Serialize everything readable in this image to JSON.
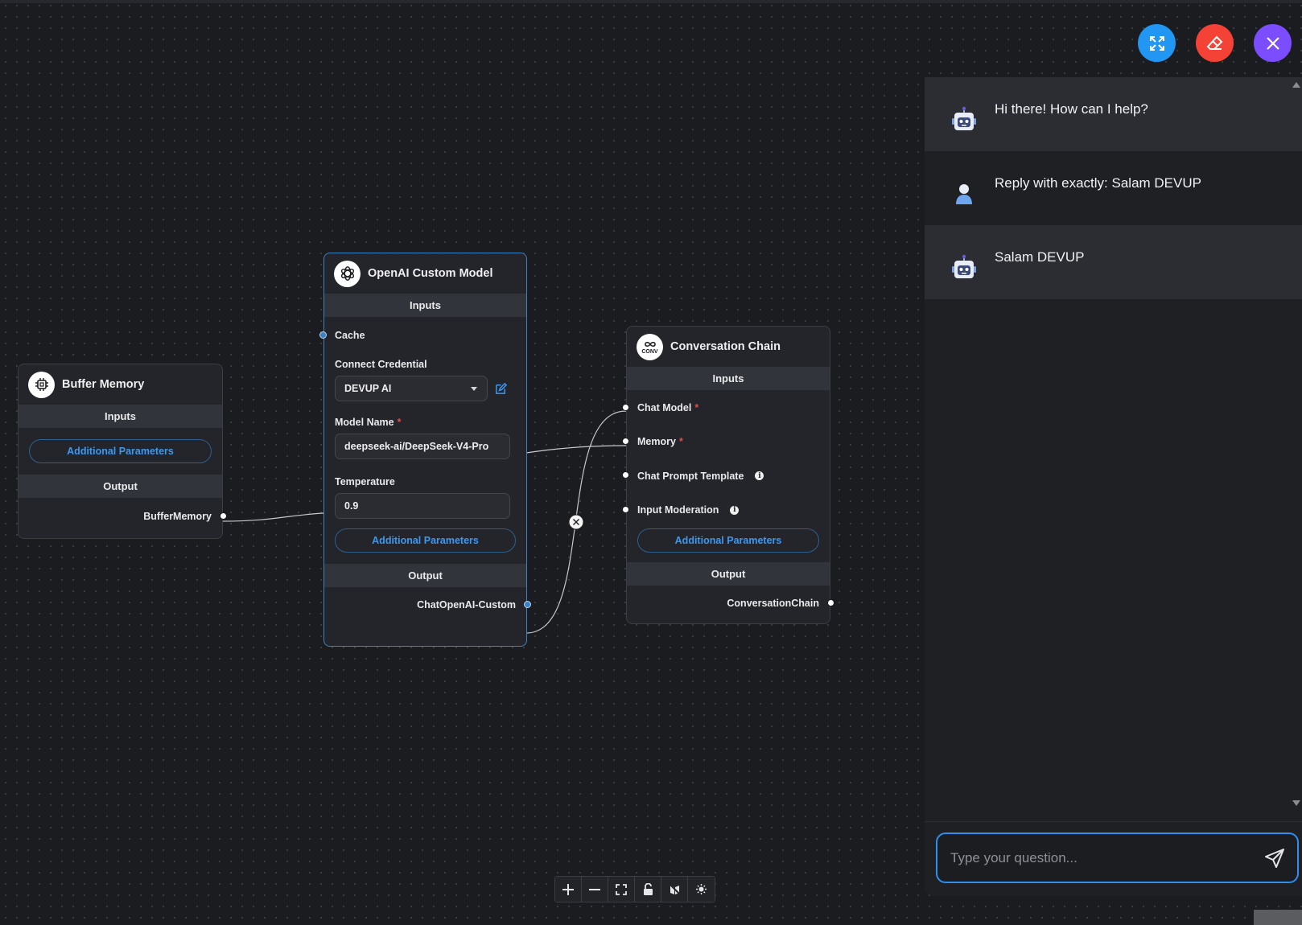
{
  "canvas": {
    "edges": [
      {
        "from": "BufferMemory",
        "to": "Memory"
      },
      {
        "from": "ChatOpenAI-Custom",
        "to": "Chat Model"
      }
    ]
  },
  "nodes": {
    "buffer_memory": {
      "title": "Buffer Memory",
      "icon": "chip-icon",
      "inputs_label": "Inputs",
      "additional_params": "Additional Parameters",
      "output_label": "Output",
      "output": "BufferMemory"
    },
    "openai_custom": {
      "title": "OpenAI Custom Model",
      "icon": "openai-icon",
      "inputs_label": "Inputs",
      "cache_label": "Cache",
      "credential_label": "Connect Credential",
      "credential_value": "DEVUP AI",
      "model_name_label": "Model Name",
      "model_name_value": "deepseek-ai/DeepSeek-V4-Pro",
      "temperature_label": "Temperature",
      "temperature_value": "0.9",
      "additional_params": "Additional Parameters",
      "output_label": "Output",
      "output": "ChatOpenAI-Custom"
    },
    "conversation_chain": {
      "title": "Conversation Chain",
      "icon": "conv-icon",
      "icon_text": "CONV",
      "inputs_label": "Inputs",
      "chat_model_label": "Chat Model",
      "memory_label": "Memory",
      "prompt_label": "Chat Prompt Template",
      "moderation_label": "Input Moderation",
      "additional_params": "Additional Parameters",
      "output_label": "Output",
      "output": "ConversationChain"
    }
  },
  "fabs": {
    "expand_color": "#2196f3",
    "clear_color": "#f44336",
    "close_color": "#7c4dff"
  },
  "chat": {
    "messages": [
      {
        "role": "bot",
        "text": "Hi there! How can I help?"
      },
      {
        "role": "user",
        "text": "Reply with exactly: Salam DEVUP"
      },
      {
        "role": "bot",
        "text": "Salam DEVUP"
      }
    ],
    "input_placeholder": "Type your question...",
    "input_value": ""
  },
  "controls": [
    "zoom-in-icon",
    "zoom-out-icon",
    "fit-view-icon",
    "lock-icon",
    "hide-icon",
    "theme-icon"
  ],
  "colors": {
    "accent": "#3b82c4",
    "link": "#3d98f2",
    "required": "#e04b4b"
  }
}
